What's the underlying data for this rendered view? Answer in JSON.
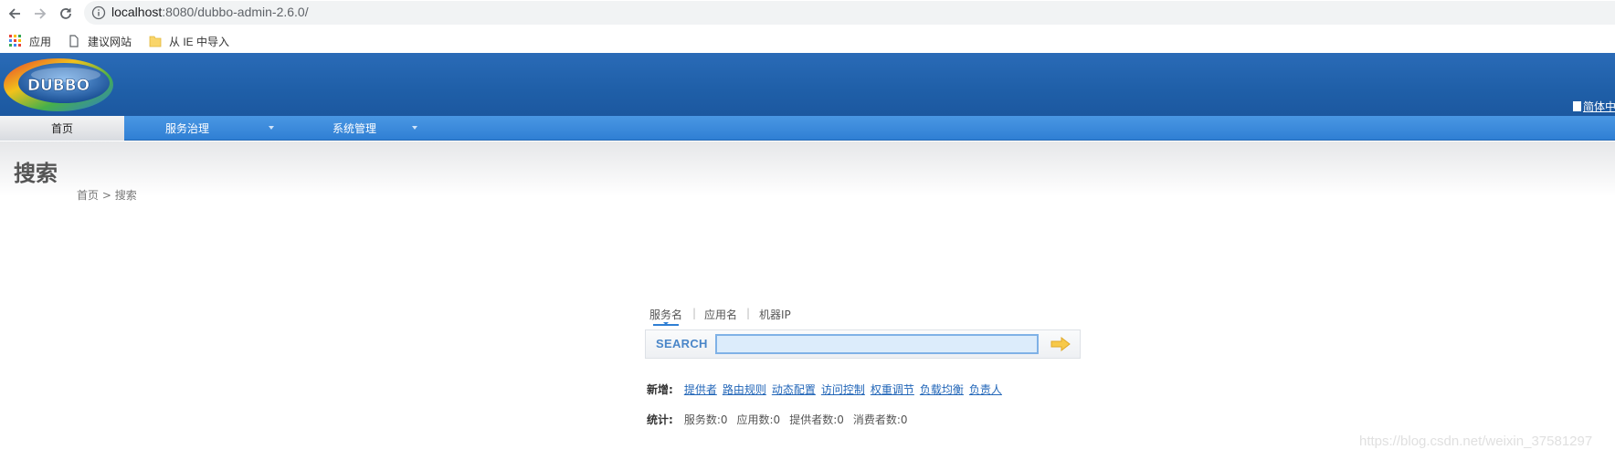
{
  "browser": {
    "url_host": "localhost",
    "url_rest": ":8080/dubbo-admin-2.6.0/",
    "bookmarks": [
      {
        "label": "应用",
        "icon": "apps-grid-icon"
      },
      {
        "label": "建议网站",
        "icon": "page-icon"
      },
      {
        "label": "从 IE 中导入",
        "icon": "folder-icon"
      }
    ]
  },
  "header": {
    "logo_text": "DUBBO",
    "language_label": "简体中",
    "brand_color": "#1f5fa8"
  },
  "menu": {
    "items": [
      {
        "label": "首页",
        "active": true
      },
      {
        "label": "服务治理",
        "active": false,
        "has_dropdown": true
      },
      {
        "label": "系统管理",
        "active": false,
        "has_dropdown": true
      }
    ]
  },
  "page": {
    "title": "搜索",
    "breadcrumb_home": "首页",
    "breadcrumb_sep": " > ",
    "breadcrumb_current": "搜索"
  },
  "search": {
    "tabs": [
      "服务名",
      "应用名",
      "机器IP"
    ],
    "tab_separator": "|",
    "active_tab": "服务名",
    "label": "SEARCH",
    "value": "",
    "placeholder": ""
  },
  "add": {
    "label": "新增:",
    "links": [
      "提供者",
      "路由规则",
      "动态配置",
      "访问控制",
      "权重调节",
      "负载均衡",
      "负责人"
    ]
  },
  "stats": {
    "label": "统计:",
    "items": [
      "服务数:0",
      "应用数:0",
      "提供者数:0",
      "消费者数:0"
    ]
  },
  "watermark": "https://blog.csdn.net/weixin_37581297"
}
